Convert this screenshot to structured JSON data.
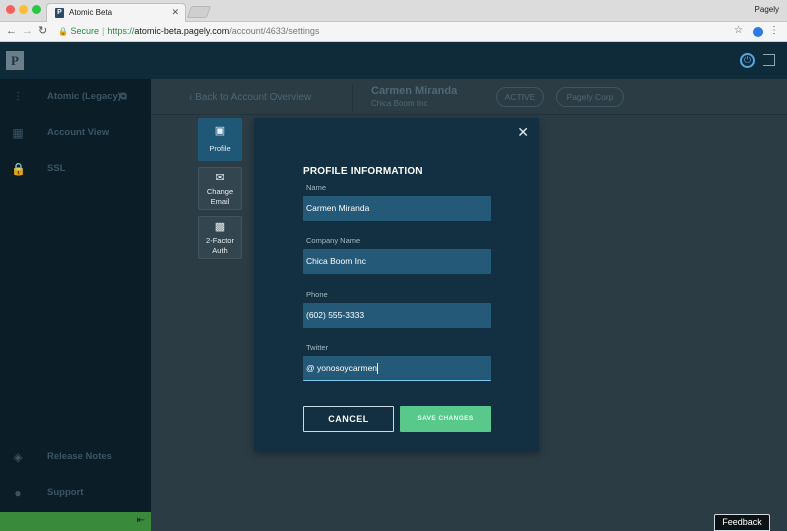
{
  "browser": {
    "tab_title": "Atomic Beta",
    "tab_favicon": "P",
    "profile_name": "Pagely",
    "secure_label": "Secure",
    "url_scheme": "https://",
    "url_host": "atomic-beta.pagely.com",
    "url_path": "/account/4633/settings"
  },
  "header": {
    "logo": "P"
  },
  "sidebar": {
    "items": [
      {
        "label": "Atomic (Legacy)",
        "icon": "waveform-icon"
      },
      {
        "label": "Account View",
        "icon": "dashboard-icon"
      },
      {
        "label": "SSL",
        "icon": "lock-icon"
      },
      {
        "label": "Release Notes",
        "icon": "tag-icon"
      },
      {
        "label": "Support",
        "icon": "chat-icon"
      }
    ]
  },
  "topbar": {
    "back_label": "Back to Account Overview",
    "customer_name": "Carmen Miranda",
    "customer_company": "Chica Boom Inc",
    "status": "ACTIVE",
    "org": "Pagely Corp"
  },
  "settings_tabs": [
    {
      "label": "Profile",
      "icon": "id-badge-icon",
      "active": true
    },
    {
      "label": "Change Email",
      "icon": "envelope-icon",
      "active": false
    },
    {
      "label": "2-Factor Auth",
      "icon": "qr-code-icon",
      "active": false
    }
  ],
  "modal": {
    "title": "PROFILE INFORMATION",
    "fields": {
      "name": {
        "label": "Name",
        "value": "Carmen Miranda"
      },
      "company": {
        "label": "Company Name",
        "value": "Chica Boom Inc"
      },
      "phone": {
        "label": "Phone",
        "value": "(602) 555-3333"
      },
      "twitter": {
        "label": "Twitter",
        "prefix": "@",
        "value": "yonosoycarmen"
      }
    },
    "cancel_label": "CANCEL",
    "save_label": "SAVE CHANGES"
  },
  "feedback_label": "Feedback",
  "colors": {
    "header_bg": "#0f2a38",
    "sidebar_bg": "#0b1e28",
    "modal_bg": "#123041",
    "input_bg": "#245a78",
    "save_green": "#58c98a",
    "active_tab": "#1f5777"
  }
}
